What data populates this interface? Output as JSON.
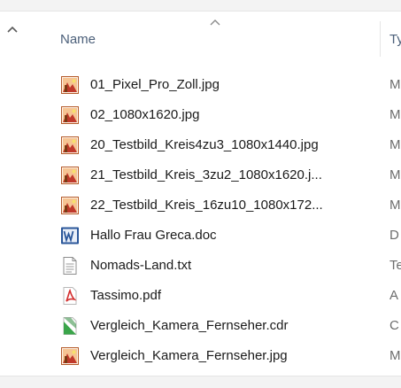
{
  "header": {
    "name_label": "Name",
    "type_label": "Ty"
  },
  "files": [
    {
      "name": "01_Pixel_Pro_Zoll.jpg",
      "type": "M",
      "icon": "jpg-image-icon"
    },
    {
      "name": "02_1080x1620.jpg",
      "type": "M",
      "icon": "jpg-image-icon"
    },
    {
      "name": "20_Testbild_Kreis4zu3_1080x1440.jpg",
      "type": "M",
      "icon": "jpg-image-icon"
    },
    {
      "name": "21_Testbild_Kreis_3zu2_1080x1620.j...",
      "type": "M",
      "icon": "jpg-image-icon"
    },
    {
      "name": "22_Testbild_Kreis_16zu10_1080x172...",
      "type": "M",
      "icon": "jpg-image-icon"
    },
    {
      "name": "Hallo Frau Greca.doc",
      "type": "D",
      "icon": "word-doc-icon"
    },
    {
      "name": "Nomads-Land.txt",
      "type": "Te",
      "icon": "text-file-icon"
    },
    {
      "name": "Tassimo.pdf",
      "type": "A",
      "icon": "pdf-file-icon"
    },
    {
      "name": "Vergleich_Kamera_Fernseher.cdr",
      "type": "C",
      "icon": "cdr-file-icon"
    },
    {
      "name": "Vergleich_Kamera_Fernseher.jpg",
      "type": "M",
      "icon": "jpg-image-icon"
    }
  ],
  "colors": {
    "header_text": "#4c607a",
    "file_text": "#1a1a1a",
    "type_text": "#6d6d6d",
    "word_blue": "#2b579a",
    "pdf_red": "#d32f2f",
    "cdr_green": "#3aa54a"
  }
}
